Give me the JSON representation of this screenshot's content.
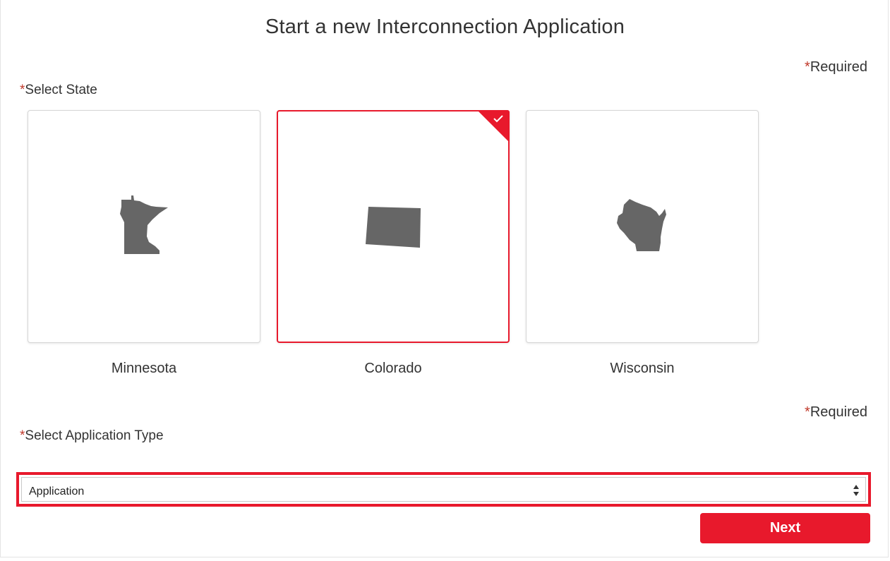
{
  "header": {
    "title": "Start a new Interconnection Application"
  },
  "state_section": {
    "required_star": "*",
    "required_text": "Required",
    "label_star": "*",
    "label": "Select State",
    "selected": "Colorado",
    "states": [
      {
        "name": "Minnesota",
        "icon": "minnesota-map-icon",
        "selected": false
      },
      {
        "name": "Colorado",
        "icon": "colorado-map-icon",
        "selected": true
      },
      {
        "name": "Wisconsin",
        "icon": "wisconsin-map-icon",
        "selected": false
      }
    ]
  },
  "type_section": {
    "required_star": "*",
    "required_text": "Required",
    "label_star": "*",
    "label": "Select Application Type",
    "select_value": "Application"
  },
  "actions": {
    "next_label": "Next"
  },
  "colors": {
    "accent": "#e8192c",
    "state_fill": "#666666",
    "text": "#333333",
    "required_star": "#c0392b"
  }
}
